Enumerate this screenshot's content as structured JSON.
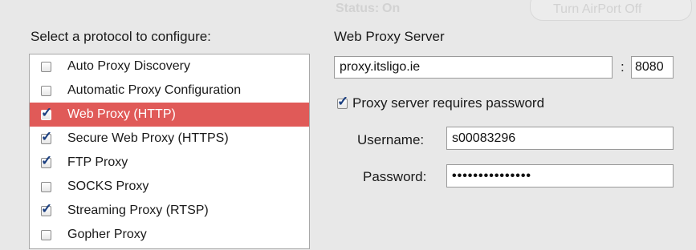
{
  "background": {
    "status_label": "Status:",
    "status_value": "On",
    "turn_button_label": "Turn AirPort Off"
  },
  "left": {
    "heading": "Select a protocol to configure:",
    "protocols": [
      {
        "label": "Auto Proxy Discovery",
        "checked": false,
        "selected": false
      },
      {
        "label": "Automatic Proxy Configuration",
        "checked": false,
        "selected": false
      },
      {
        "label": "Web Proxy (HTTP)",
        "checked": true,
        "selected": true
      },
      {
        "label": "Secure Web Proxy (HTTPS)",
        "checked": true,
        "selected": false
      },
      {
        "label": "FTP Proxy",
        "checked": true,
        "selected": false
      },
      {
        "label": "SOCKS Proxy",
        "checked": false,
        "selected": false
      },
      {
        "label": "Streaming Proxy (RTSP)",
        "checked": true,
        "selected": false
      },
      {
        "label": "Gopher Proxy",
        "checked": false,
        "selected": false
      }
    ]
  },
  "right": {
    "heading": "Web Proxy Server",
    "server": "proxy.itsligo.ie",
    "colon": ":",
    "port": "8080",
    "requires_password_label": "Proxy server requires password",
    "requires_password_checked": true,
    "username_label": "Username:",
    "username": "s00083296",
    "password_label": "Password:",
    "password_masked": "•••••••••••••••"
  },
  "colors": {
    "selection": "#e05a58",
    "checkmark": "#1b3f80"
  }
}
